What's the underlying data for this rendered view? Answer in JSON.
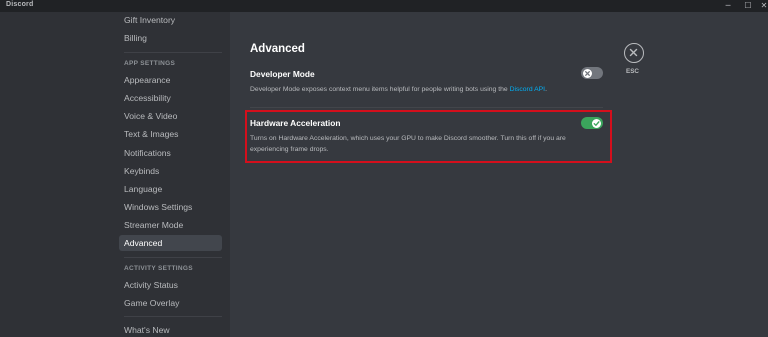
{
  "window": {
    "title": "Discord",
    "minimize_glyph": "─",
    "maximize_glyph": "☐",
    "close_glyph": "✕"
  },
  "sidebar": {
    "top_items": [
      {
        "label": "Gift Inventory"
      },
      {
        "label": "Billing"
      }
    ],
    "app_settings_header": "APP SETTINGS",
    "app_settings_items": [
      {
        "label": "Appearance"
      },
      {
        "label": "Accessibility"
      },
      {
        "label": "Voice & Video"
      },
      {
        "label": "Text & Images"
      },
      {
        "label": "Notifications"
      },
      {
        "label": "Keybinds"
      },
      {
        "label": "Language"
      },
      {
        "label": "Windows Settings"
      },
      {
        "label": "Streamer Mode"
      },
      {
        "label": "Advanced",
        "active": true
      }
    ],
    "activity_settings_header": "ACTIVITY SETTINGS",
    "activity_settings_items": [
      {
        "label": "Activity Status"
      },
      {
        "label": "Game Overlay"
      }
    ],
    "whats_new": "What's New"
  },
  "main": {
    "title": "Advanced",
    "developer_mode": {
      "title": "Developer Mode",
      "description_prefix": "Developer Mode exposes context menu items helpful for people writing bots using the ",
      "link_text": "Discord API",
      "description_suffix": ".",
      "enabled": false
    },
    "hardware_acceleration": {
      "title": "Hardware Acceleration",
      "description": "Turns on Hardware Acceleration, which uses your GPU to make Discord smoother. Turn this off if you are experiencing frame drops.",
      "enabled": true
    },
    "close_label": "ESC",
    "close_icon": "close-x-icon"
  },
  "colors": {
    "accent_green": "#3ba55c",
    "link_blue": "#00aff4",
    "highlight_red": "#d40f1c"
  }
}
